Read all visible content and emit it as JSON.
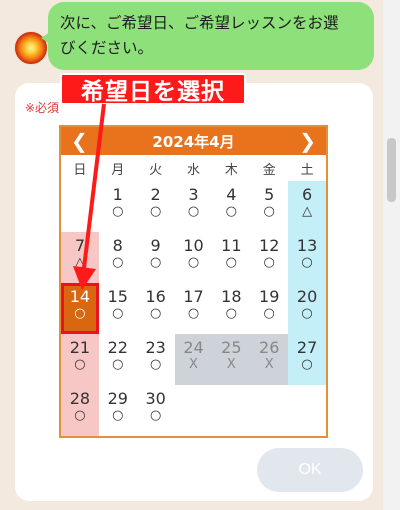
{
  "message": {
    "text_line1": "次に、ご希望日、ご希望レッスンをお選",
    "text_line2": "びください。"
  },
  "form": {
    "required_label": "※必須",
    "ok_label": "OK"
  },
  "annotation": {
    "label": "希望日を選択",
    "color": "#ff1a1a"
  },
  "calendar": {
    "title": "2024年4月",
    "prev_icon": "chevron-left-icon",
    "next_icon": "chevron-right-icon",
    "weekdays": [
      "日",
      "月",
      "火",
      "水",
      "木",
      "金",
      "土"
    ],
    "weeks": [
      [
        {
          "day": "",
          "mark": ""
        },
        {
          "day": "1",
          "mark": "○"
        },
        {
          "day": "2",
          "mark": "○"
        },
        {
          "day": "3",
          "mark": "○"
        },
        {
          "day": "4",
          "mark": "○"
        },
        {
          "day": "5",
          "mark": "○"
        },
        {
          "day": "6",
          "mark": "△"
        }
      ],
      [
        {
          "day": "7",
          "mark": "△"
        },
        {
          "day": "8",
          "mark": "○"
        },
        {
          "day": "9",
          "mark": "○"
        },
        {
          "day": "10",
          "mark": "○"
        },
        {
          "day": "11",
          "mark": "○"
        },
        {
          "day": "12",
          "mark": "○"
        },
        {
          "day": "13",
          "mark": "○"
        }
      ],
      [
        {
          "day": "14",
          "mark": "○"
        },
        {
          "day": "15",
          "mark": "○"
        },
        {
          "day": "16",
          "mark": "○"
        },
        {
          "day": "17",
          "mark": "○"
        },
        {
          "day": "18",
          "mark": "○"
        },
        {
          "day": "19",
          "mark": "○"
        },
        {
          "day": "20",
          "mark": "○"
        }
      ],
      [
        {
          "day": "21",
          "mark": "○"
        },
        {
          "day": "22",
          "mark": "○"
        },
        {
          "day": "23",
          "mark": "○"
        },
        {
          "day": "24",
          "mark": "X"
        },
        {
          "day": "25",
          "mark": "X"
        },
        {
          "day": "26",
          "mark": "X"
        },
        {
          "day": "27",
          "mark": "○"
        }
      ],
      [
        {
          "day": "28",
          "mark": "○"
        },
        {
          "day": "29",
          "mark": "○"
        },
        {
          "day": "30",
          "mark": "○"
        },
        {
          "day": "",
          "mark": ""
        },
        {
          "day": "",
          "mark": ""
        },
        {
          "day": "",
          "mark": ""
        },
        {
          "day": "",
          "mark": ""
        }
      ]
    ],
    "selected_day": "14",
    "colors": {
      "header": "#e8731c",
      "sunday": "#f6c7c4",
      "saturday": "#c4eef8",
      "unavailable": "#ced2d9",
      "selected": "#d8670f"
    }
  }
}
